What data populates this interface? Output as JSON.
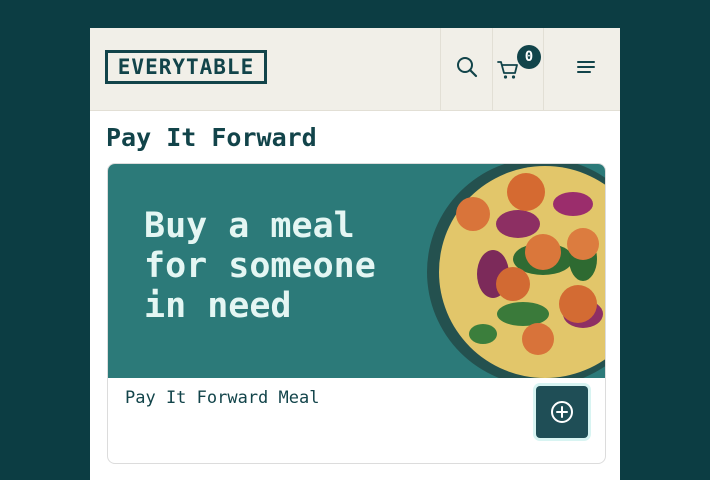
{
  "header": {
    "logo_text": "EVERYTABLE",
    "cart_count": "0",
    "icons": [
      "search-icon",
      "cart-icon",
      "hamburger-menu-icon"
    ]
  },
  "page": {
    "title": "Pay It Forward"
  },
  "card": {
    "banner_text": "Buy a meal\nfor someone\nin need",
    "meal_name": "Pay It Forward Meal",
    "add_icon": "plus-circle-icon"
  },
  "colors": {
    "background": "#0c3d43",
    "header_bg": "#f1efe8",
    "brand": "#12444a",
    "banner_bg": "#2c7a79",
    "banner_text": "#e4f6f3"
  }
}
